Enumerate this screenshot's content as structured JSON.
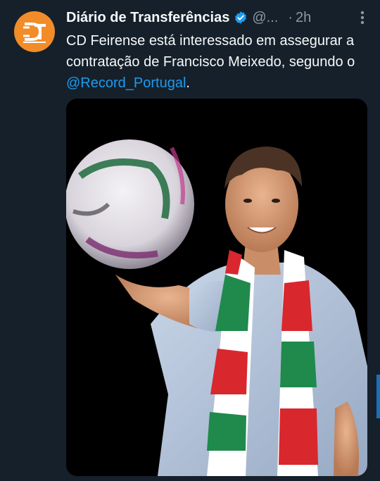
{
  "tweet": {
    "author_name": "Diário de Transferências",
    "author_handle": "@...",
    "separator": "·",
    "timestamp": "2h",
    "avatar_icon": "dt-logo-icon",
    "verified_icon": "verified-badge-icon",
    "more_icon": "more-options-icon",
    "text_before_mention": "CD Feirense está interessado em assegurar a contratação de Francisco Meixedo, segundo o ",
    "mention": "@Record_Portugal",
    "text_after_mention": ".",
    "media": {
      "description_icon": "photo-player-with-ball",
      "colors": {
        "background": "#000000",
        "scarf_green": "#1f8a4c",
        "scarf_red": "#d9272e",
        "shirt": "#b8c9e0"
      }
    }
  },
  "colors": {
    "background": "#15202b",
    "accent": "#1d9bf0",
    "muted": "#8b98a5",
    "avatar": "#f28c28"
  }
}
